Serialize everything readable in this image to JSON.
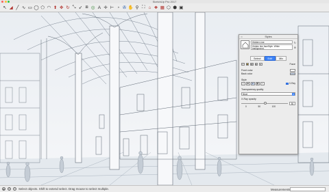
{
  "window": {
    "title": "SketchUp Pro 2017"
  },
  "colors": {
    "accent": "#3b82f6",
    "traffic_close": "#ff5f57",
    "traffic_min": "#febc2e",
    "traffic_max": "#28c840"
  },
  "toolbar": {
    "tools": [
      {
        "name": "select-tool-icon",
        "glyph": "↖"
      },
      {
        "name": "eraser-tool-icon",
        "glyph": "◢"
      },
      {
        "name": "line-tool-icon",
        "glyph": "╱"
      },
      {
        "name": "freehand-tool-icon",
        "glyph": "∿"
      },
      {
        "name": "rectangle-tool-icon",
        "glyph": "▭"
      },
      {
        "name": "circle-tool-icon",
        "glyph": "◯"
      },
      {
        "name": "polygon-tool-icon",
        "glyph": "⬠"
      },
      {
        "name": "arc-tool-icon",
        "glyph": "◠"
      },
      {
        "name": "pushpull-tool-icon",
        "glyph": "⬆"
      },
      {
        "name": "move-tool-icon",
        "glyph": "✥"
      },
      {
        "name": "rotate-tool-icon",
        "glyph": "↻"
      },
      {
        "name": "scale-tool-icon",
        "glyph": "⤡"
      },
      {
        "name": "followme-tool-icon",
        "glyph": "➶"
      },
      {
        "name": "offset-tool-icon",
        "glyph": "⧈"
      },
      {
        "name": "tape-tool-icon",
        "glyph": "◎"
      },
      {
        "name": "text-tool-icon",
        "glyph": "A"
      },
      {
        "name": "axes-tool-icon",
        "glyph": "✛"
      },
      {
        "name": "dimension-tool-icon",
        "glyph": "⊢"
      },
      {
        "name": "protractor-tool-icon",
        "glyph": "◔"
      },
      {
        "name": "orbit-tool-icon",
        "glyph": "✇"
      },
      {
        "name": "pan-tool-icon",
        "glyph": "✋"
      },
      {
        "name": "zoom-tool-icon",
        "glyph": "⚲"
      },
      {
        "name": "zoom-extents-icon",
        "glyph": "⛶"
      },
      {
        "name": "warehouse-icon",
        "glyph": "⌂"
      },
      {
        "name": "extension-icon",
        "glyph": "❖"
      },
      {
        "name": "layout-icon",
        "glyph": "▦"
      },
      {
        "name": "iso-view-icon",
        "glyph": "⬡"
      },
      {
        "name": "top-view-icon",
        "glyph": "⬢"
      },
      {
        "name": "front-view-icon",
        "glyph": "▣"
      }
    ]
  },
  "status": {
    "text": "Select objects. Shift to extend select. Drag mouse to select multiple.",
    "measurements_label": "Measurements"
  },
  "styles_panel": {
    "title": "Styles",
    "style_name": "Hidden Line",
    "style_description": "Hidden line faceStyle. White background.",
    "tabs": [
      {
        "label": "Select",
        "active": false
      },
      {
        "label": "Edit",
        "active": true
      },
      {
        "label": "Mix",
        "active": false
      }
    ],
    "face_label": "Face",
    "front_color_label": "Front color",
    "back_color_label": "Back color",
    "front_color": "#ffffff",
    "back_color": "#b7c4d6",
    "style_label": "Style",
    "xray_label": "X-Ray",
    "transparency_label": "Transparency quality",
    "transparency_value": "Nicer",
    "xray_opacity_label": "X-Ray opacity",
    "xray_opacity_value": "50",
    "ticks": [
      "0",
      "50",
      "100"
    ]
  }
}
